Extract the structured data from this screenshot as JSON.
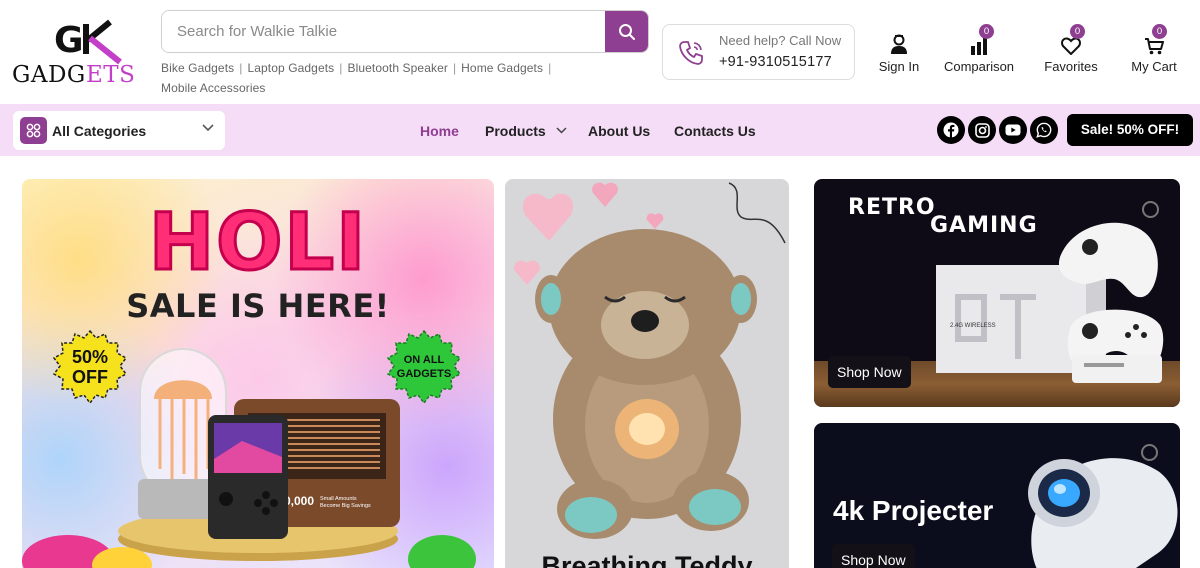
{
  "brand": {
    "logo_mark": "GK",
    "logo_text": "GADGETS"
  },
  "search": {
    "placeholder": "Search for Walkie Talkie"
  },
  "quick_links": [
    "Bike Gadgets",
    "Laptop Gadgets",
    "Bluetooth Speaker",
    "Home Gadgets",
    "Mobile Accessories"
  ],
  "help": {
    "label": "Need help? Call Now",
    "phone": "+91-9310515177"
  },
  "header_actions": {
    "sign_in": {
      "label": "Sign In",
      "icon": "user-icon"
    },
    "comparison": {
      "label": "Comparison",
      "count": "0",
      "icon": "bar-chart-icon"
    },
    "favorites": {
      "label": "Favorites",
      "count": "0",
      "icon": "heart-icon"
    },
    "cart": {
      "label": "My Cart",
      "count": "0",
      "icon": "cart-icon"
    }
  },
  "nav": {
    "categories_label": "All Categories",
    "links": [
      {
        "label": "Home",
        "active": true
      },
      {
        "label": "Products",
        "dropdown": true
      },
      {
        "label": "About Us"
      },
      {
        "label": "Contacts Us"
      }
    ],
    "social": [
      "facebook-icon",
      "instagram-icon",
      "youtube-icon",
      "whatsapp-icon"
    ],
    "sale_label": "Sale! 50% OFF!"
  },
  "banners": {
    "holi": {
      "title": "HOLI",
      "subtitle": "SALE IS HERE!",
      "badge_left_line1": "50%",
      "badge_left_line2": "OFF",
      "badge_right_line1": "ON ALL",
      "badge_right_line2": "GADGETS",
      "product_text": "0,000",
      "product_subtext_1": "Small Amounts",
      "product_subtext_2": "Become Big Savings"
    },
    "teddy": {
      "title": "Breathing Teddy"
    },
    "retro": {
      "title_line1": "RETRO",
      "title_line2": "GAMING",
      "cta": "Shop Now",
      "product_text": "2.4G WIRELESS"
    },
    "projector": {
      "title": "4k Projecter",
      "cta": "Shop Now"
    }
  },
  "colors": {
    "accent": "#8e3f91",
    "nav_bg": "#f5dcf7",
    "holi_pink": "#ff2e77"
  }
}
